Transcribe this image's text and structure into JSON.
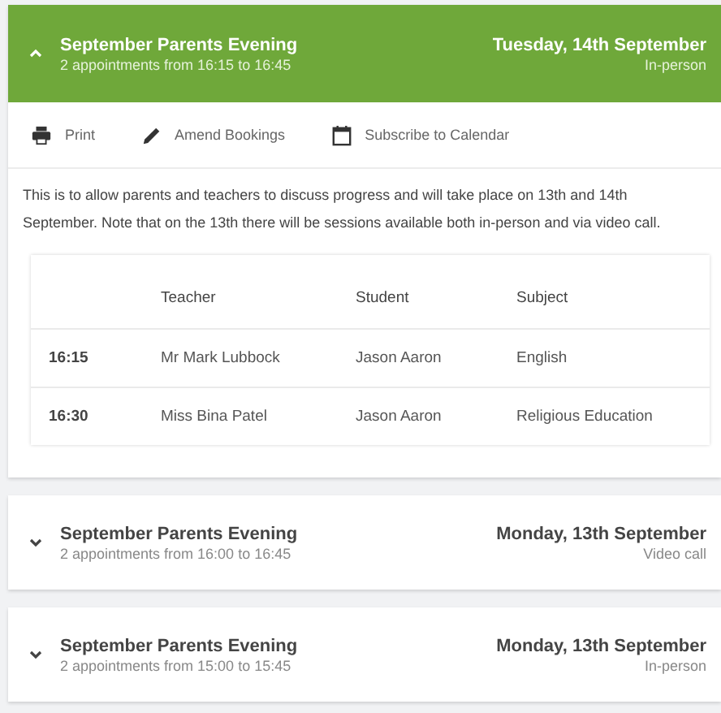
{
  "events": [
    {
      "title": "September Parents Evening",
      "summary": "2 appointments from 16:15 to 16:45",
      "date": "Tuesday, 14th September",
      "mode": "In-person",
      "expanded": true,
      "details": {
        "actions": [
          {
            "kind": "print",
            "label": "Print"
          },
          {
            "kind": "amend",
            "label": "Amend Bookings"
          },
          {
            "kind": "calendar",
            "label": "Subscribe to Calendar"
          }
        ],
        "description": "This is to allow parents and teachers to discuss progress and will take place on 13th and 14th September. Note that on the 13th there will be sessions available both in-person and via video call.",
        "columns": [
          "Teacher",
          "Student",
          "Subject"
        ],
        "rows": [
          {
            "time": "16:15",
            "teacher": "Mr Mark Lubbock",
            "student": "Jason Aaron",
            "subject": "English"
          },
          {
            "time": "16:30",
            "teacher": "Miss Bina Patel",
            "student": "Jason Aaron",
            "subject": "Religious Education"
          }
        ]
      }
    },
    {
      "title": "September Parents Evening",
      "summary": "2 appointments from 16:00 to 16:45",
      "date": "Monday, 13th September",
      "mode": "Video call",
      "expanded": false
    },
    {
      "title": "September Parents Evening",
      "summary": "2 appointments from 15:00 to 15:45",
      "date": "Monday, 13th September",
      "mode": "In-person",
      "expanded": false
    }
  ]
}
